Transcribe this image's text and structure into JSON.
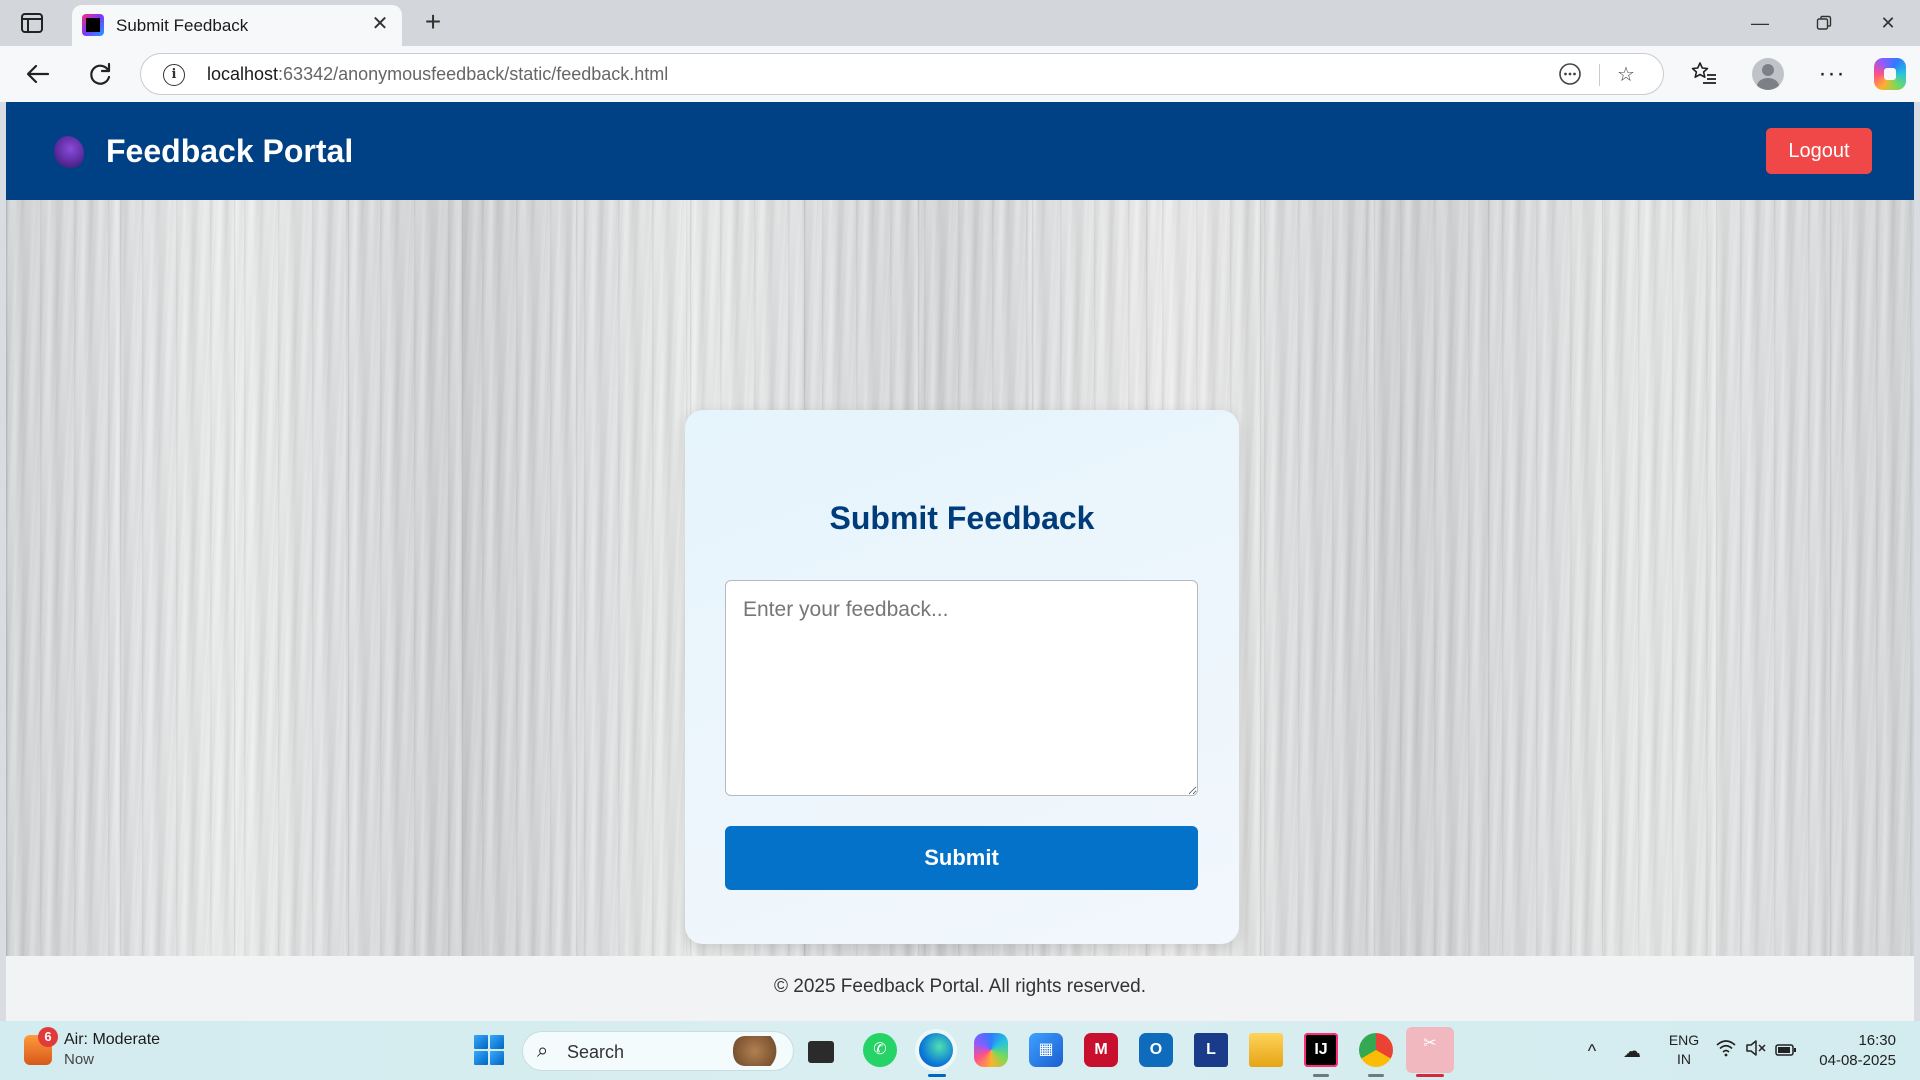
{
  "browser": {
    "tab_title": "Submit Feedback",
    "url_host": "localhost",
    "url_rest": ":63342/anonymousfeedback/static/feedback.html",
    "icons": {
      "tab_panel": "tab-panel-icon",
      "close_tab": "close-icon",
      "new_tab": "plus-icon",
      "minimize": "minimize-icon",
      "restore": "restore-icon",
      "close_window": "close-icon",
      "back": "back-arrow-icon",
      "refresh": "refresh-icon",
      "site_info": "info-icon",
      "reader": "more-circle-icon",
      "favorite": "star-icon",
      "favorites_list": "favorites-icon",
      "profile": "profile-icon",
      "menu": "more-icon",
      "copilot": "copilot-icon"
    }
  },
  "page": {
    "header": {
      "title": "Feedback Portal",
      "logout_label": "Logout"
    },
    "form": {
      "title": "Submit Feedback",
      "feedback_placeholder": "Enter your feedback...",
      "feedback_value": "",
      "submit_label": "Submit"
    },
    "footer": {
      "text": "© 2025 Feedback Portal. All rights reserved."
    },
    "colors": {
      "header_bg": "#004085",
      "logout_bg": "#f04848",
      "submit_bg": "#0572c9",
      "title_color": "#003c7a"
    }
  },
  "taskbar": {
    "weather": {
      "title": "Air: Moderate",
      "subtitle": "Now",
      "badge": "6"
    },
    "search_label": "Search",
    "apps": [
      {
        "name": "task-view-icon"
      },
      {
        "name": "whatsapp-icon"
      },
      {
        "name": "edge-icon"
      },
      {
        "name": "copilot-icon"
      },
      {
        "name": "microsoft-store-icon"
      },
      {
        "name": "mcafee-icon"
      },
      {
        "name": "outlook-icon"
      },
      {
        "name": "l-app-icon",
        "label": "L"
      },
      {
        "name": "file-explorer-icon"
      },
      {
        "name": "intellij-icon"
      },
      {
        "name": "chrome-icon"
      },
      {
        "name": "snipping-tool-icon"
      }
    ],
    "tray": {
      "lang_line1": "ENG",
      "lang_line2": "IN",
      "time": "16:30",
      "date": "04-08-2025"
    }
  }
}
